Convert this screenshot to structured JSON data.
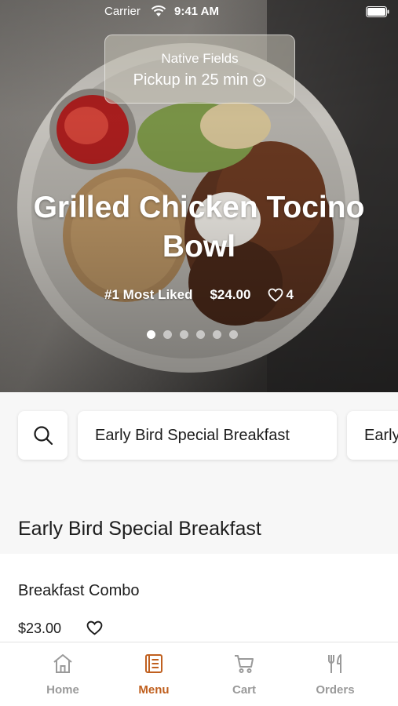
{
  "status_bar": {
    "carrier": "Carrier",
    "time": "9:41 AM"
  },
  "pickup": {
    "store_name": "Native Fields",
    "pickup_text": "Pickup in 25 min"
  },
  "hero": {
    "title": "Grilled Chicken Tocino Bowl",
    "tag": "#1 Most Liked",
    "price": "$24.00",
    "likes": "4",
    "carousel_total": 6,
    "carousel_active": 1
  },
  "categories": {
    "chips": [
      {
        "label": "Early Bird Special Breakfast"
      },
      {
        "label": "Early Bird Special Breakfast"
      }
    ]
  },
  "menu": {
    "section_title": "Early Bird Special Breakfast",
    "items": [
      {
        "name": "Breakfast Combo",
        "price": "$23.00"
      }
    ]
  },
  "tabs": [
    {
      "label": "Home",
      "icon": "home-icon"
    },
    {
      "label": "Menu",
      "icon": "menu-book-icon"
    },
    {
      "label": "Cart",
      "icon": "cart-icon"
    },
    {
      "label": "Orders",
      "icon": "fork-knife-icon"
    }
  ],
  "colors": {
    "accent": "#c0601f",
    "tab_inactive": "#9a9a9a"
  }
}
